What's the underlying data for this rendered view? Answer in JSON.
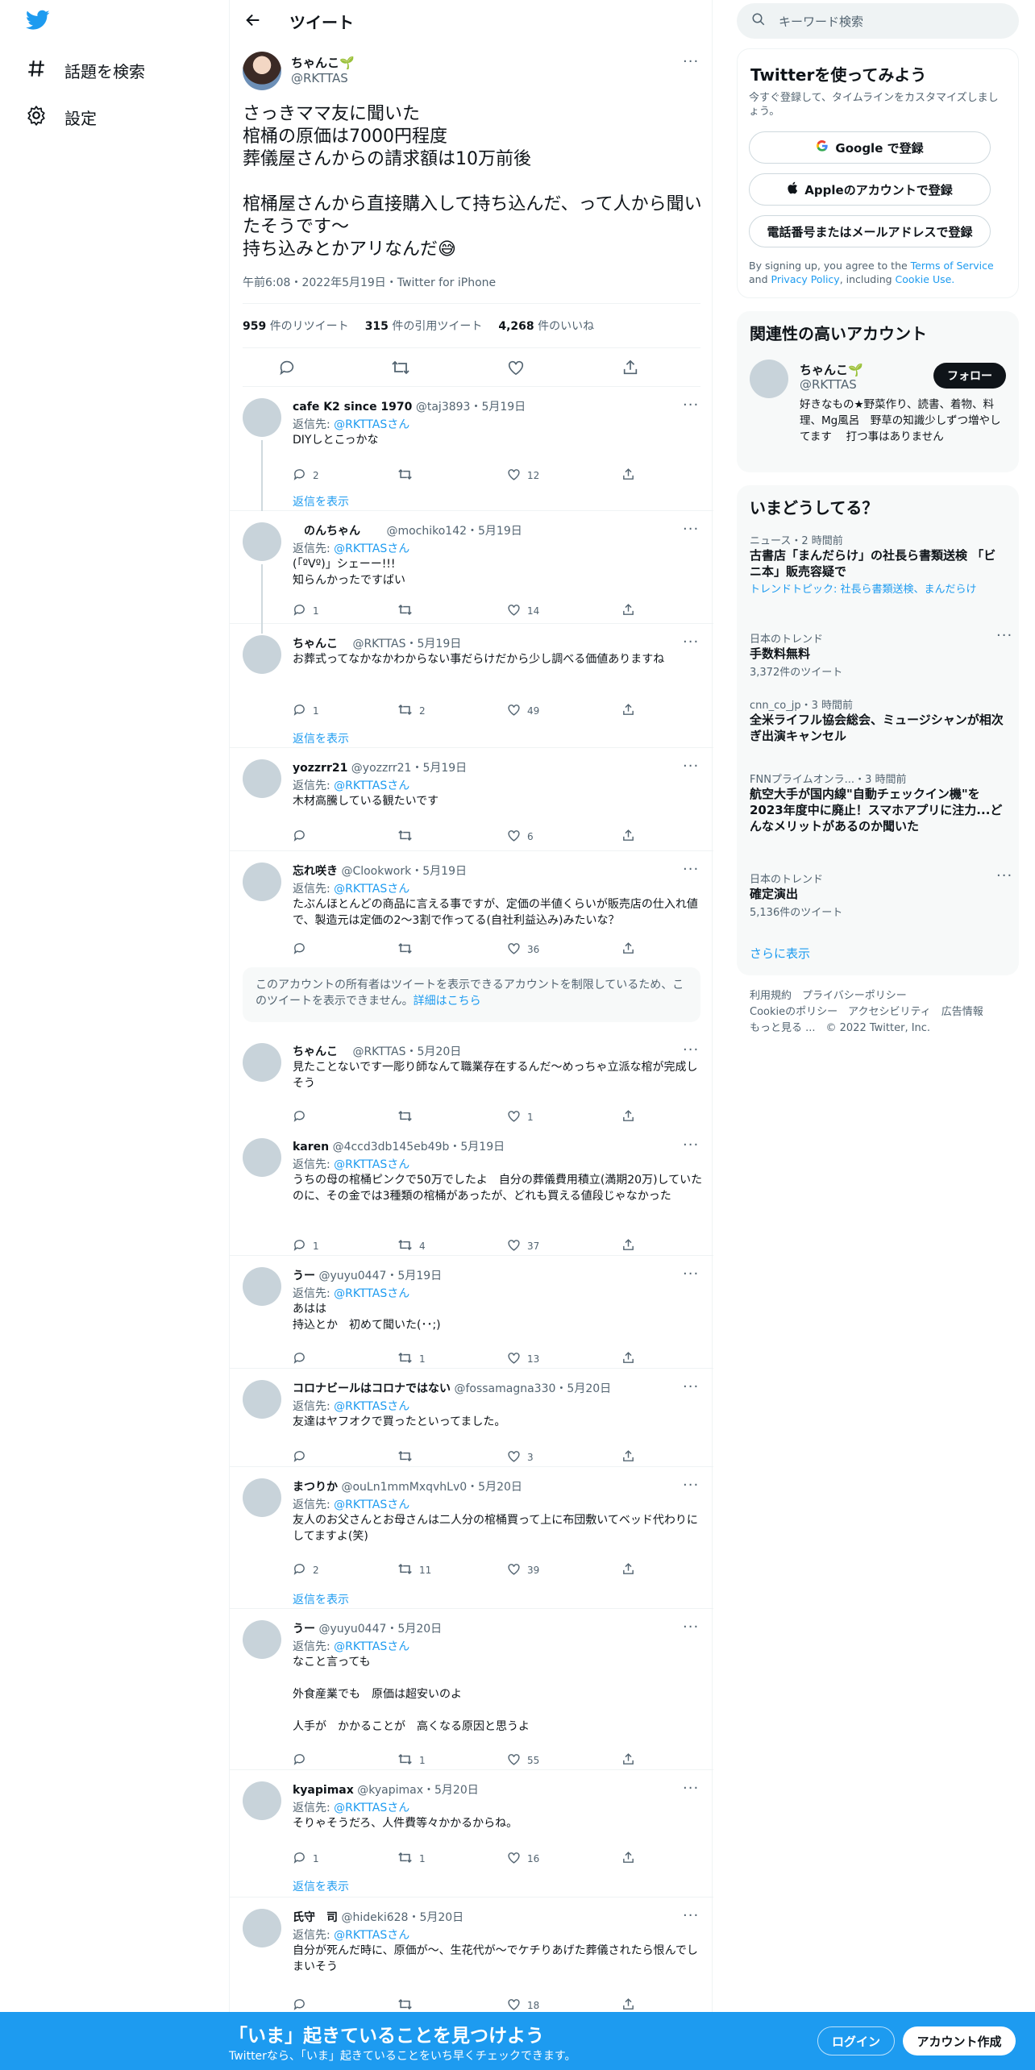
{
  "nav": {
    "explore_label": "話題を検索",
    "settings_label": "設定"
  },
  "header": {
    "title": "ツイート"
  },
  "tweet": {
    "name": "ちゃんこ🌱",
    "handle": "@RKTTAS",
    "text": "さっきママ友に聞いた\n棺桶の原価は7000円程度\n葬儀屋さんからの請求額は10万前後\n\n棺桶屋さんから直接購入して持ち込んだ、って人から聞いたそうです〜\n持ち込みとかアリなんだ😅",
    "meta": "午前6:08・2022年5月19日・Twitter for iPhone",
    "retweets": "959",
    "retweets_label": "件のリツイート",
    "quotes": "315",
    "quotes_label": "件の引用ツイート",
    "likes": "4,268",
    "likes_label": "件のいいね"
  },
  "reply_to_label": "返信先:",
  "reply_to_handle": "@RKTTAS",
  "reply_to_suffix": "さん",
  "show_replies_label": "返信を表示",
  "restricted": {
    "text": "このアカウントの所有者はツイートを表示できるアカウントを制限しているため、このツイートを表示できません。",
    "link": "詳細はこちら"
  },
  "replies": [
    {
      "name": "cafe K2 since 1970",
      "handle": "@taj3893",
      "date": "5月19日",
      "text": "DIYしとこっかな",
      "replies": "2",
      "retweets": "",
      "likes": "12"
    },
    {
      "name": "　のんちゃん　　",
      "handle": "@mochiko142",
      "date": "5月19日",
      "text": "(「ºVº)」シェーー!!!\n知らんかったですばい",
      "replies": "1",
      "retweets": "",
      "likes": "14"
    },
    {
      "name": "ちゃんこ　",
      "handle": "@RKTTAS",
      "date": "5月19日",
      "text": "お葬式ってなかなかわからない事だらけだから少し調べる価値ありますね",
      "replies": "1",
      "retweets": "2",
      "likes": "49"
    },
    {
      "name": "yozzrr21",
      "handle": "@yozzrr21",
      "date": "5月19日",
      "text": "木材高騰している観たいです",
      "replies": "",
      "retweets": "",
      "likes": "6"
    },
    {
      "name": "忘れ咲き",
      "handle": "@Clookwork",
      "date": "5月19日",
      "text": "たぶんほとんどの商品に言える事ですが、定価の半値くらいが販売店の仕入れ値で、製造元は定価の2～3割で作ってる(自社利益込み)みたいな？",
      "replies": "",
      "retweets": "",
      "likes": "36"
    },
    {
      "name": "ちゃんこ　",
      "handle": "@RKTTAS",
      "date": "5月20日",
      "text": "見たことないです一彫り師なんて職業存在するんだ〜めっちゃ立派な棺が完成しそう",
      "replies": "",
      "retweets": "",
      "likes": "1"
    },
    {
      "name": "karen",
      "handle": "@4ccd3db145eb49b",
      "date": "5月19日",
      "text": "うちの母の棺桶ピンクで50万でしたよ　自分の葬儀費用積立(満期20万)していたのに、その金では3種類の棺桶があったが、どれも買える値段じゃなかった",
      "replies": "1",
      "retweets": "4",
      "likes": "37"
    },
    {
      "name": "うー",
      "handle": "@yuyu0447",
      "date": "5月19日",
      "text": "あはは\n持込とか　初めて聞いた(･･;)",
      "replies": "",
      "retweets": "1",
      "likes": "13"
    },
    {
      "name": "コロナビールはコロナではない",
      "handle": "@fossamagna330",
      "date": "5月20日",
      "text": "友達はヤフオクで買ったといってました。",
      "replies": "",
      "retweets": "",
      "likes": "3"
    },
    {
      "name": "まつりか",
      "handle": "@ouLn1mmMxqvhLv0",
      "date": "5月20日",
      "text": "友人のお父さんとお母さんは二人分の棺桶買って上に布団敷いてベッド代わりにしてますよ(笑)",
      "replies": "2",
      "retweets": "11",
      "likes": "39"
    },
    {
      "name": "うー",
      "handle": "@yuyu0447",
      "date": "5月20日",
      "text": "なこと言っても\n\n外食産業でも　原価は超安いのよ\n\n人手が　かかることが　高くなる原因と思うよ",
      "replies": "",
      "retweets": "1",
      "likes": "55"
    },
    {
      "name": "kyapimax",
      "handle": "@kyapimax",
      "date": "5月20日",
      "text": "そりゃそうだろ、人件費等々かかるからね。",
      "replies": "1",
      "retweets": "1",
      "likes": "16"
    },
    {
      "name": "氏守　司",
      "handle": "@hideki628",
      "date": "5月20日",
      "text": "自分が死んだ時に、原価が〜、生花代が〜でケチりあげた葬儀されたら恨んでしまいそう",
      "replies": "",
      "retweets": "",
      "likes": "18"
    }
  ],
  "sidebar": {
    "search_placeholder": "キーワード検索",
    "signup": {
      "title": "Twitterを使ってみよう",
      "subtitle": "今すぐ登録して、タイムラインをカスタマイズしましょう。",
      "google": "Google で登録",
      "apple": "Appleのアカウントで登録",
      "phone": "電話番号またはメールアドレスで登録",
      "terms_pre": "By signing up, you agree to the ",
      "terms_link": "Terms of Service",
      "terms_and": " and ",
      "privacy_link": "Privacy Policy",
      "terms_including": ", including ",
      "cookie_link": "Cookie Use."
    },
    "related": {
      "title": "関連性の高いアカウント",
      "name": "ちゃんこ🌱",
      "handle": "@RKTTAS",
      "follow": "フォロー",
      "bio": "好きなもの★野菜作り、読書、着物、料理、Mg風呂　野草の知識少しずつ増やしてます　 打つ事はありません"
    },
    "trends": {
      "title": "いまどうしてる？",
      "items": [
        {
          "context": "ニュース・2 時間前",
          "title": "古書店「まんだらけ」の社長ら書類送検 「ビニ本」販売容疑で",
          "sub": "トレンドトピック: 社長ら書類送検、まんだらけ",
          "count": ""
        },
        {
          "context": "日本のトレンド",
          "title": "手数料無料",
          "sub": "",
          "count": "3,372件のツイート"
        },
        {
          "context": "cnn_co_jp・3 時間前",
          "title": "全米ライフル協会総会、ミュージシャンが相次ぎ出演キャンセル",
          "sub": "",
          "count": ""
        },
        {
          "context": "FNNプライムオンラ...・3 時間前",
          "title": "航空大手が国内線\"自動チェックイン機\"を2023年度中に廃止！スマホアプリに注力...どんなメリットがあるのか聞いた",
          "sub": "",
          "count": ""
        },
        {
          "context": "日本のトレンド",
          "title": "確定演出",
          "sub": "",
          "count": "5,136件のツイート"
        }
      ],
      "show_more": "さらに表示"
    },
    "footer": {
      "line1": "利用規約　プライバシーポリシー",
      "line2": "Cookieのポリシー　アクセシビリティ　広告情報",
      "line3": "もっと見る ...　© 2022 Twitter, Inc."
    }
  },
  "bottom_bar": {
    "title": "「いま」起きていることを見つけよう",
    "subtitle": "Twitterなら、「いま」起きていることをいち早くチェックできます。",
    "login": "ログイン",
    "signup": "アカウント作成"
  },
  "colors": {
    "accent": "#1d9bf0",
    "text": "#0f1419",
    "muted": "#536471"
  }
}
